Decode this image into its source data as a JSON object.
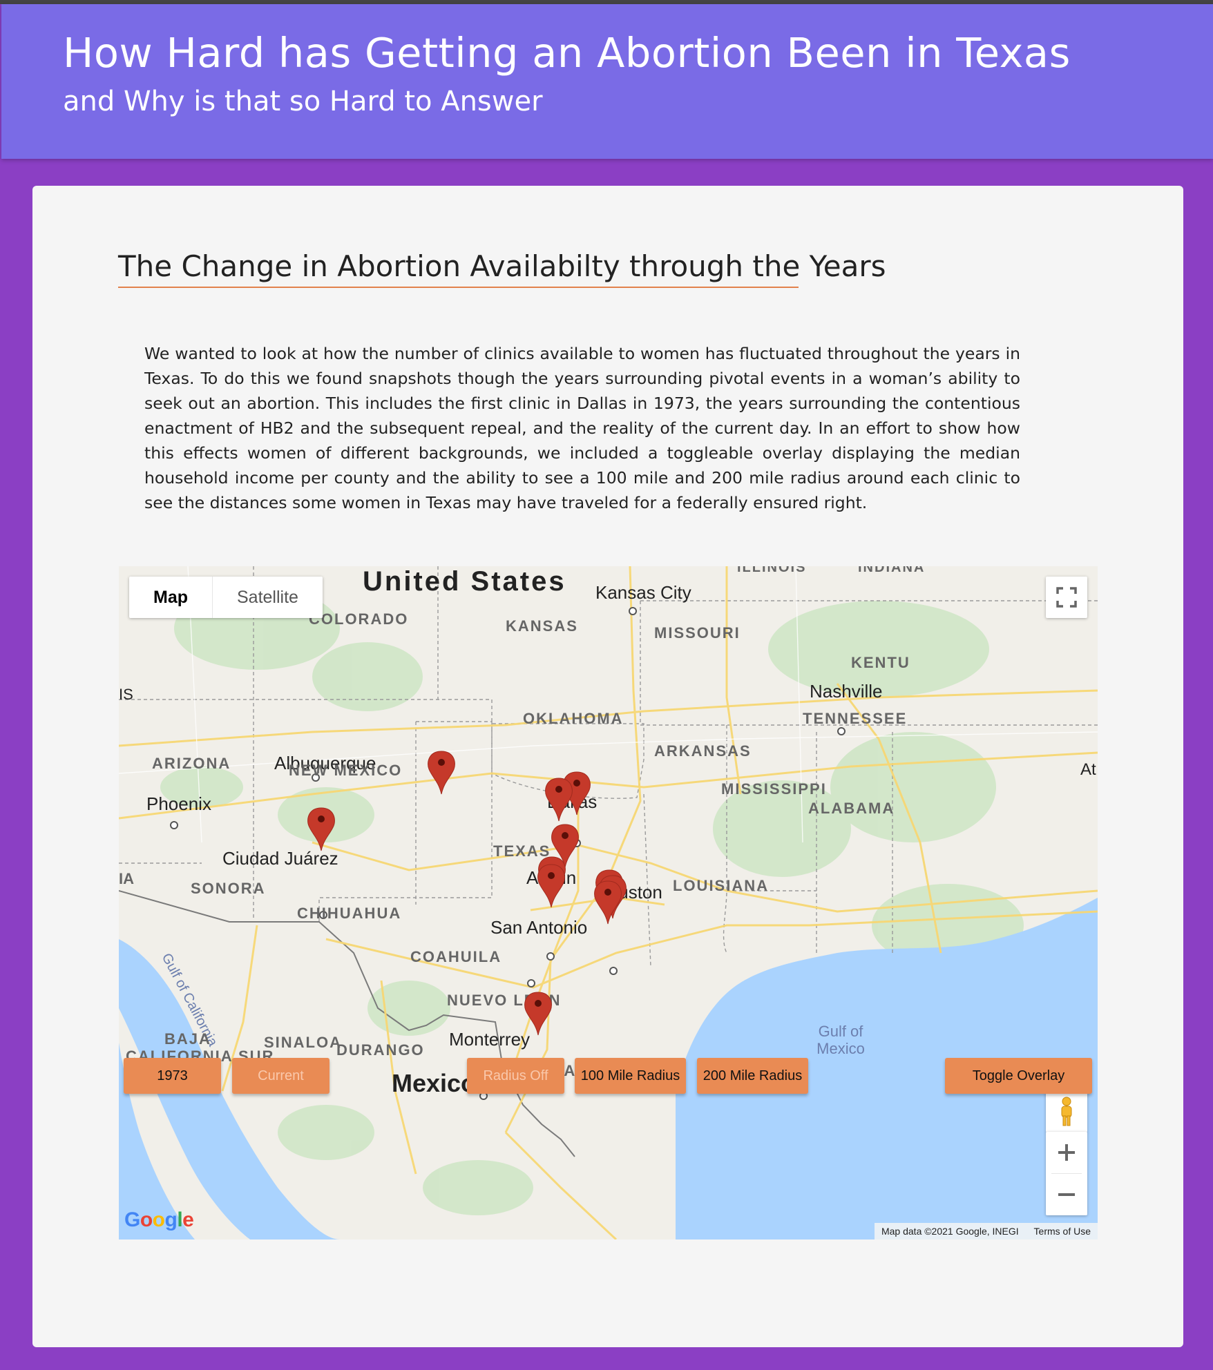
{
  "header": {
    "title": "How Hard has Getting an Abortion Been in Texas",
    "subtitle": "and Why is that so Hard to Answer"
  },
  "section": {
    "title": "The Change in Abortion Availabilty through the Years",
    "paragraph": "We wanted to look at how the number of clinics available to women has fluctuated throughout the years in Texas. To do this we found snapshots though the years surrounding pivotal events in a woman’s ability to seek out an abortion. This includes the first clinic in Dallas in 1973, the years surrounding the contentious enactment of HB2 and the subsequent repeal, and the reality of the current day. In an effort to show how this effects women of different backgrounds, we included a toggleable overlay displaying the median household income per county and the ability to see a 100 mile and 200 mile radius around each clinic to see the distances some women in Texas may have traveled for a federally ensured right."
  },
  "map": {
    "type_control": {
      "map": "Map",
      "satellite": "Satellite",
      "selected": "Map"
    },
    "labels": {
      "united_states": "United States",
      "kansas_city": "Kansas City",
      "colorado": "COLORADO",
      "kansas": "KANSAS",
      "missouri": "MISSOURI",
      "kentucky_partial": "KENTU",
      "nashville": "Nashville",
      "tennessee": "TENNESSEE",
      "oklahoma": "OKLAHOMA",
      "albuquerque": "Albuquerque",
      "arkansas": "ARKANSAS",
      "arizona": "ARIZONA",
      "new_mexico": "NEW MEXICO",
      "atlanta_partial": "At",
      "mississippi": "MISSISSIPPI",
      "phoenix": "Phoenix",
      "dallas": "Dallas",
      "alabama": "ALABAMA",
      "ciudad_juarez": "Ciudad Juárez",
      "texas": "TEXAS",
      "austin": "Austin",
      "houston": "Houston",
      "louisiana": "LOUISIANA",
      "sonora": "SONORA",
      "chihuahua": "CHIHUAHUA",
      "san_antonio": "San Antonio",
      "coahuila": "COAHUILA",
      "gulf_of_california": "Gulf of California",
      "nuevo_leon": "NUEVO LEON",
      "baja": "BAJA",
      "california_sur": "CALIFORNIA SUR",
      "sinaloa": "SINALOA",
      "durango": "DURANGO",
      "monterrey": "Monterrey",
      "gulf_of_mexico_1": "Gulf of",
      "gulf_of_mexico_2": "Mexico",
      "tamaulipas": "TAMAULIPAS",
      "mexico": "Mexico",
      "illinois_partial": "ILLINOIS",
      "indiana_partial": "INDIANA",
      "left_is": "IS",
      "left_ia": "IA"
    },
    "logo": "Google",
    "attribution": "Map data ©2021 Google, INEGI",
    "terms": "Terms of Use",
    "marker_color": "#c5392a",
    "water_color": "#aad3fe"
  },
  "buttons": {
    "y1973": "1973",
    "current": "Current",
    "radius_off": "Radius Off",
    "r100": "100 Mile Radius",
    "r200": "200 Mile Radius",
    "overlay": "Toggle Overlay"
  },
  "colors": {
    "background": "#8b3fc4",
    "header": "#7a6be6",
    "button": "#e98b54",
    "title_rule": "#e2814c"
  }
}
